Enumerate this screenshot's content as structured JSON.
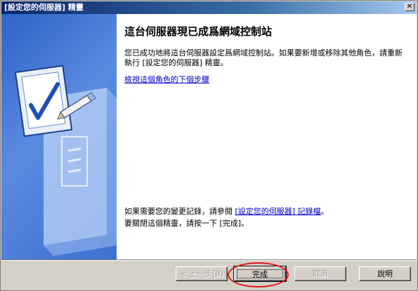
{
  "window": {
    "title": "[設定您的伺服器] 精靈",
    "close_glyph": "✕"
  },
  "main": {
    "heading": "這台伺服器現已成爲網域控制站",
    "description": "您已成功地將這台伺服器設定爲網域控制站。如果要新增或移除其他角色，請重新執行 [設定您的伺服器] 精靈。",
    "next_steps_link": "檢視這個角色的下個步驟",
    "logs_prefix": "如果需要您的變更記錄，請參閱 ",
    "logs_link": "[設定您的伺服器] 記錄檔",
    "logs_suffix": "。",
    "close_instruction": "要關閉這個精靈，請按一下 [完成]。"
  },
  "buttons": {
    "back": "< 上一步(B)",
    "finish": "完成",
    "cancel": "取消",
    "help": "說明"
  },
  "colors": {
    "annotation_ring": "#e0191a",
    "side_panel": "#3f70d0"
  },
  "icons": {
    "side_illustration": "server-checklist-icon"
  }
}
